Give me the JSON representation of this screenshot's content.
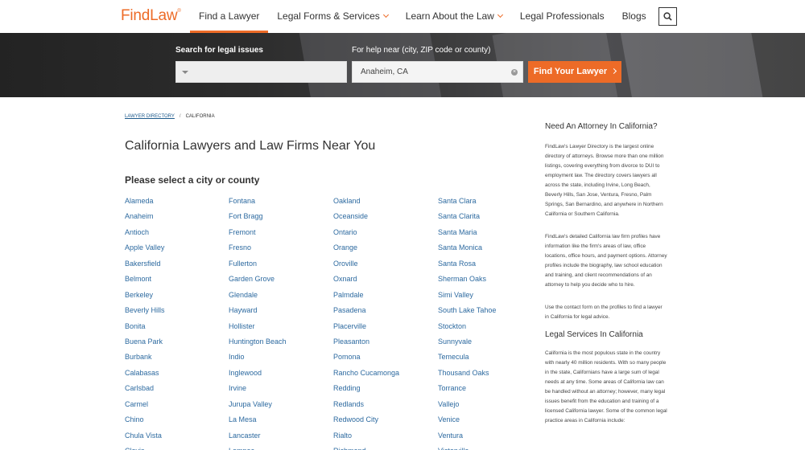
{
  "header": {
    "logo": "FindLaw",
    "logo_mark": "®",
    "nav": [
      {
        "label": "Find a Lawyer",
        "active": true,
        "dropdown": false
      },
      {
        "label": "Legal Forms & Services",
        "active": false,
        "dropdown": true
      },
      {
        "label": "Learn About the Law",
        "active": false,
        "dropdown": true
      },
      {
        "label": "Legal Professionals",
        "active": false,
        "dropdown": false
      },
      {
        "label": "Blogs",
        "active": false,
        "dropdown": false
      }
    ],
    "search_icon": "search-icon"
  },
  "hero": {
    "issues_label": "Search for legal issues",
    "issues_value": "",
    "near_label": "For help near (city, ZIP code or county)",
    "near_value": "Anaheim, CA",
    "find_button": "Find Your Lawyer"
  },
  "breadcrumb": {
    "root": "LAWYER DIRECTORY",
    "separator": "/",
    "current": "CALIFORNIA"
  },
  "main": {
    "title": "California Lawyers and Law Firms Near You",
    "select_heading": "Please select a city or county",
    "cities": [
      [
        "Alameda",
        "Anaheim",
        "Antioch",
        "Apple Valley",
        "Bakersfield",
        "Belmont",
        "Berkeley",
        "Beverly Hills",
        "Bonita",
        "Buena Park",
        "Burbank",
        "Calabasas",
        "Carlsbad",
        "Carmel",
        "Chino",
        "Chula Vista",
        "Clovis"
      ],
      [
        "Fontana",
        "Fort Bragg",
        "Fremont",
        "Fresno",
        "Fullerton",
        "Garden Grove",
        "Glendale",
        "Hayward",
        "Hollister",
        "Huntington Beach",
        "Indio",
        "Inglewood",
        "Irvine",
        "Jurupa Valley",
        "La Mesa",
        "Lancaster",
        "Lompoc"
      ],
      [
        "Oakland",
        "Oceanside",
        "Ontario",
        "Orange",
        "Oroville",
        "Oxnard",
        "Palmdale",
        "Pasadena",
        "Placerville",
        "Pleasanton",
        "Pomona",
        "Rancho Cucamonga",
        "Redding",
        "Redlands",
        "Redwood City",
        "Rialto",
        "Richmond"
      ],
      [
        "Santa Clara",
        "Santa Clarita",
        "Santa Maria",
        "Santa Monica",
        "Santa Rosa",
        "Sherman Oaks",
        "Simi Valley",
        "South Lake Tahoe",
        "Stockton",
        "Sunnyvale",
        "Temecula",
        "Thousand Oaks",
        "Torrance",
        "Vallejo",
        "Venice",
        "Ventura",
        "Victorville"
      ]
    ]
  },
  "sidebar": {
    "heading1": "Need An Attorney In California?",
    "para1": "FindLaw's Lawyer Directory is the largest online directory of attorneys. Browse more than one million listings, covering everything from divorce to DUI to employment law. The directory covers lawyers all across the state, including Irvine, Long Beach, Beverly Hills, San Jose, Ventura, Fresno, Palm Springs, San Bernardino, and anywhere in Northern California or Southern California.",
    "para2": "FindLaw's detailed California law firm profiles have information like the firm's areas of law, office locations, office hours, and payment options. Attorney profiles include the biography, law school education and training, and client recommendations of an attorney to help you decide who to hire.",
    "para3": "Use the contact form on the profiles to find a lawyer in California for legal advice.",
    "heading2": "Legal Services In California",
    "para4": "California is the most populous state in the country with nearly 40 million residents. With so many people in the state, Californians have a large sum of legal needs at any time. Some areas of California law can be handled without an attorney; however, many legal issues benefit from the education and training of a licensed California lawyer. Some of the common legal practice areas in California include:"
  },
  "colors": {
    "brand": "#ed6b27",
    "link": "#2d6aa0"
  }
}
